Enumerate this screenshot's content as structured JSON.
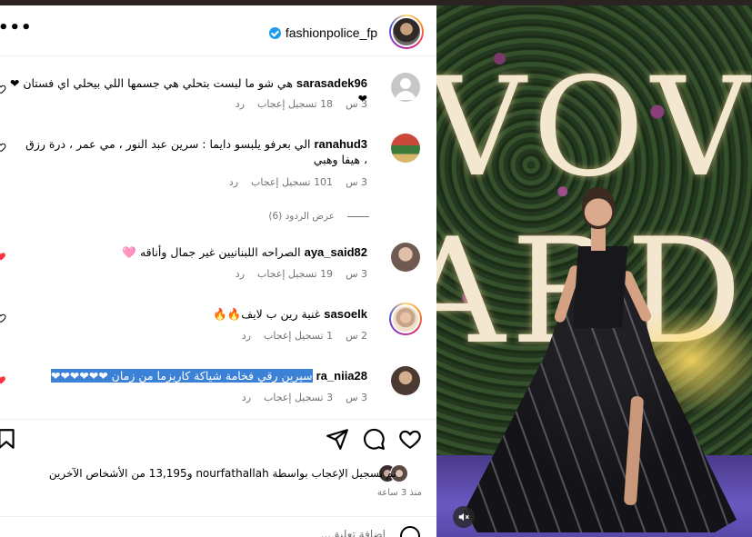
{
  "header": {
    "username": "fashionpolice_fp",
    "more_label": "•••"
  },
  "comments": [
    {
      "username": "sarasadek96",
      "text": "هي شو ما لبست بتحلي هي جسمها اللي بيحلي اي فستان ❤❤",
      "time": "3 س",
      "likes": "18 تسجيل إعجاب",
      "reply": "رد",
      "liked": false
    },
    {
      "username": "ranahud3",
      "text": "الي بعرفو يلبسو دايما : سرين عبد النور ، مي عمر ، درة رزق ، هيفا وهبي",
      "time": "3 س",
      "likes": "101 تسجيل إعجاب",
      "reply": "رد",
      "liked": false
    },
    {
      "username": "aya_said82",
      "text": "الصراحه اللبنانيين غير جمال وأناقه 🩷",
      "time": "3 س",
      "likes": "19 تسجيل إعجاب",
      "reply": "رد",
      "liked": true
    },
    {
      "username": "sasoelk",
      "text": "غنية رين ب لايف🔥🔥",
      "time": "2 س",
      "likes": "1 تسجيل إعجاب",
      "reply": "رد",
      "liked": false
    },
    {
      "username": "ra_niia28",
      "text": "سيرين رقي فخامة شياكة كاريزما من زمان ❤❤❤❤❤❤",
      "time": "3 س",
      "likes": "3 تسجيل إعجاب",
      "reply": "رد",
      "liked": true
    }
  ],
  "view_replies": "عرض الردود (6)",
  "likes_summary": "تم تسجيل الإعجاب بواسطة nourfathallah و13,195 من الأشخاص الآخرين",
  "time_ago": "منذ 3 ساعة",
  "add_comment_placeholder": "إضافة تعليق...",
  "colors": {
    "accent_blue": "#1d9bf0",
    "like_red": "#ff3040",
    "highlight": "#3b82d6"
  },
  "icons": {
    "like": "heart-outline-icon",
    "comment": "comment-bubble-icon",
    "share": "send-paper-plane-icon",
    "save": "bookmark-icon",
    "mute": "speaker-muted-icon",
    "emoji": "smiley-emoji-icon",
    "more": "more-dots-icon"
  },
  "photo": {
    "backdrop_letters_row1": "VOV",
    "backdrop_letters_row2": "ARDS"
  }
}
